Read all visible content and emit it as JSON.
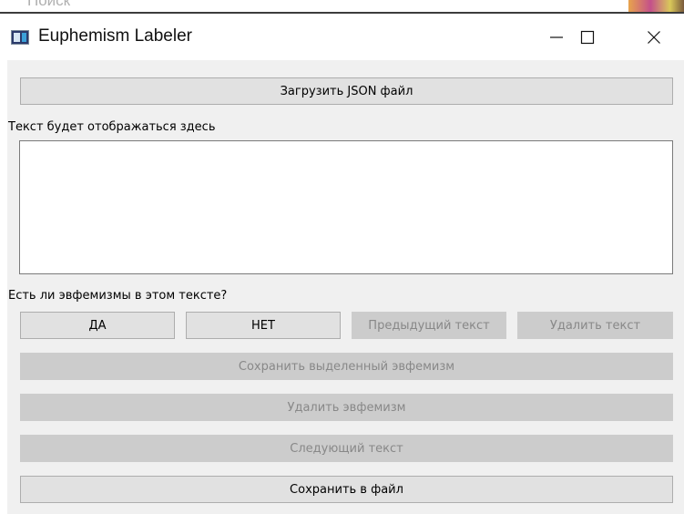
{
  "background_window": {
    "search_text": "Поиск"
  },
  "window": {
    "title": "Euphemism Labeler",
    "app_icon": "app-window-icon",
    "controls": {
      "minimize_icon": "minimize-icon",
      "maximize_icon": "maximize-icon",
      "close_icon": "close-icon"
    }
  },
  "main": {
    "load_json_button": "Загрузить JSON файл",
    "text_caption": "Текст будет отображаться здесь",
    "text_area_value": "",
    "question_label": "Есть ли эвфемизмы в этом тексте?",
    "yes_button": "ДА",
    "no_button": "НЕТ",
    "previous_text_button": "Предыдущий текст",
    "delete_text_button": "Удалить текст",
    "save_selected_euphemism_button": "Сохранить выделенный эвфемизм",
    "delete_euphemism_button": "Удалить эвфемизм",
    "next_text_button": "Следующий текст",
    "save_to_file_button": "Сохранить в файл"
  },
  "colors": {
    "client_background": "#f0f0f0",
    "button_background": "#e1e1e1",
    "disabled_button_background": "#cccccc",
    "disabled_text": "#888888"
  }
}
